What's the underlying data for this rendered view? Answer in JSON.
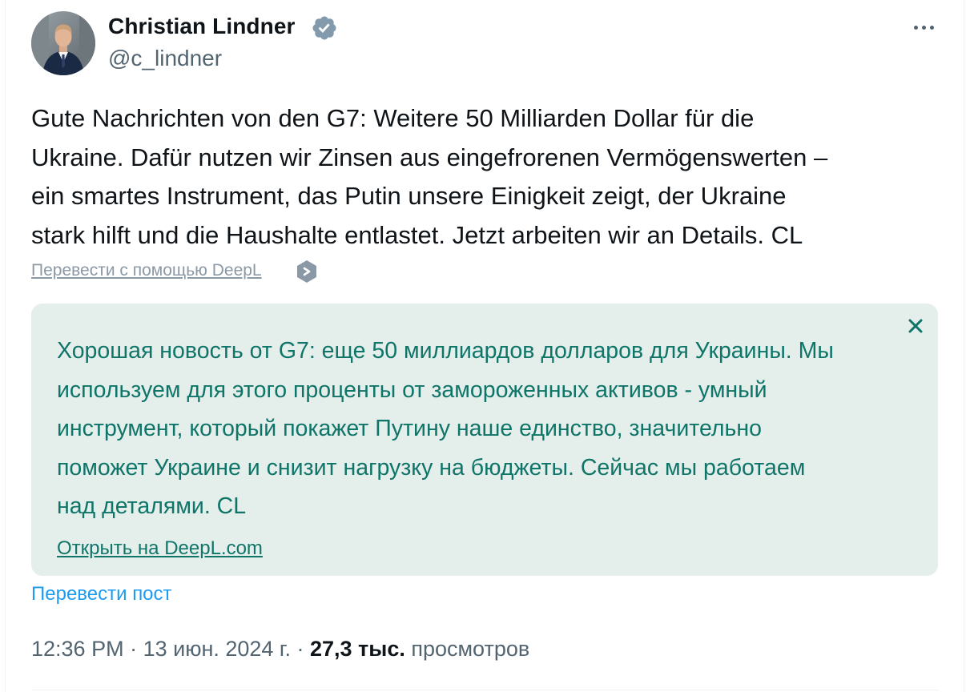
{
  "author": {
    "name": "Christian Lindner",
    "handle": "@c_lindner",
    "verified": true,
    "avatar_icon": "person-portrait"
  },
  "tweet": {
    "text_lines": [
      "Gute Nachrichten von den G7: Weitere 50 Milliarden Dollar für die",
      "Ukraine. Dafür nutzen wir Zinsen aus eingefrorenen Vermögenswerten –",
      "ein smartes Instrument, das Putin unsere Einigkeit zeigt, der Ukraine",
      "stark hilft und die Haushalte entlastet. Jetzt arbeiten wir an Details. CL"
    ]
  },
  "translate_with_deepl": "Перевести с помощью DeepL",
  "translation": {
    "text_lines": [
      "Хорошая новость от G7: еще 50 миллиардов долларов для Украины. Мы",
      "используем для этого проценты от замороженных активов - умный",
      "инструмент, который покажет Путину наше единство, значительно",
      "поможет Украине и снизит нагрузку на бюджеты. Сейчас мы работаем",
      "над деталями. CL"
    ],
    "open_link": "Открыть на DeepL.com"
  },
  "translate_post": "Перевести пост",
  "meta": {
    "time": "12:36 PM",
    "separator": " · ",
    "date": "13 июн. 2024 г.",
    "views_count": "27,3 тыс.",
    "views_label": " просмотров"
  },
  "colors": {
    "accent": "#1d9bf0",
    "deepl_green": "#0f7569",
    "translation_bg": "#e4eeeb",
    "secondary_text": "#536471"
  }
}
